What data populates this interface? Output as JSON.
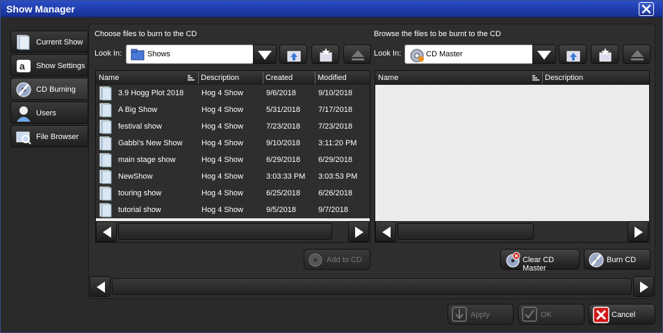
{
  "window": {
    "title": "Show Manager"
  },
  "nav": {
    "items": [
      {
        "label": "Current Show",
        "icon": "book-icon"
      },
      {
        "label": "Show Settings",
        "icon": "show-a-icon"
      },
      {
        "label": "CD Burning",
        "icon": "cd-burn-icon"
      },
      {
        "label": "Users",
        "icon": "user-icon"
      },
      {
        "label": "File Browser",
        "icon": "folder-search-icon"
      }
    ],
    "active": "CD Burning"
  },
  "left": {
    "heading": "Choose files to burn to the CD",
    "lookin_label": "Look In:",
    "lookin_value": "Shows",
    "columns": [
      "Name",
      "Description",
      "Created",
      "Modified"
    ],
    "rows": [
      {
        "name": "3.9 Hogg Plot 2018",
        "description": "Hog 4 Show",
        "created": "9/6/2018",
        "modified": "9/10/2018"
      },
      {
        "name": "A Big Show",
        "description": "Hog 4 Show",
        "created": "5/31/2018",
        "modified": "7/17/2018"
      },
      {
        "name": "festival show",
        "description": "Hog 4 Show",
        "created": "7/23/2018",
        "modified": "7/23/2018"
      },
      {
        "name": "Gabbi's New Show",
        "description": "Hog 4 Show",
        "created": "9/10/2018",
        "modified": "3:11:20 PM"
      },
      {
        "name": "main stage show",
        "description": "Hog 4 Show",
        "created": "6/29/2018",
        "modified": "6/29/2018"
      },
      {
        "name": "NewShow",
        "description": "Hog 4 Show",
        "created": "3:03:33 PM",
        "modified": "3:03:53 PM"
      },
      {
        "name": "touring show",
        "description": "Hog 4 Show",
        "created": "6/25/2018",
        "modified": "6/26/2018"
      },
      {
        "name": "tutorial show",
        "description": "Hog 4 Show",
        "created": "9/5/2018",
        "modified": "9/7/2018"
      }
    ],
    "add_button": "Add to CD"
  },
  "right": {
    "heading": "Browse the files to be burnt to the CD",
    "lookin_label": "Look In:",
    "lookin_value": "CD Master",
    "columns": [
      "Name",
      "Description"
    ],
    "clear_button": "Clear CD Master",
    "burn_button": "Burn CD"
  },
  "footer": {
    "apply": "Apply",
    "ok": "OK",
    "cancel": "Cancel"
  },
  "colors": {
    "titlebar": "#1e3aa8",
    "panel": "#2e2e2e",
    "list_bg": "#ebebeb",
    "cancel_red": "#d01818"
  }
}
